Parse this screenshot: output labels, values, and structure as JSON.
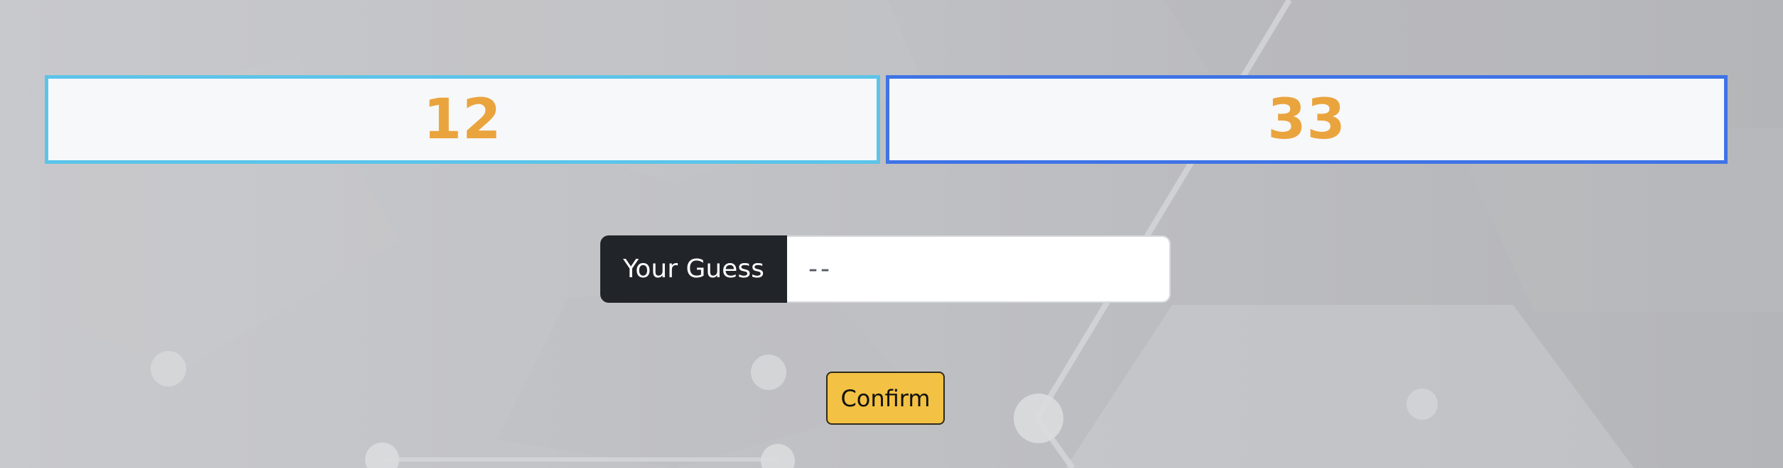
{
  "scores": {
    "left_value": "12",
    "right_value": "33"
  },
  "guess": {
    "label": "Your Guess",
    "placeholder": "--",
    "value": ""
  },
  "actions": {
    "confirm_label": "Confirm"
  },
  "colors": {
    "left_border": "#5cc4e9",
    "right_border": "#3f73e6",
    "number": "#eaa43d",
    "confirm_bg": "#f3c143",
    "label_bg": "#212529"
  }
}
